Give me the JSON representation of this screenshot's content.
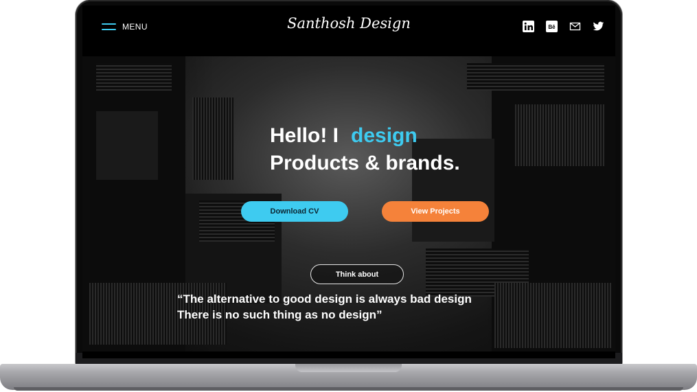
{
  "navbar": {
    "menu_label": "MENU",
    "logo": "Santhosh Design",
    "social_icons": [
      "linkedin-icon",
      "behance-icon",
      "mail-icon",
      "twitter-icon"
    ]
  },
  "hero": {
    "headline_line1": "Hello! I",
    "headline_word": "design",
    "headline_line2": "Products & brands.",
    "download_label": "Download CV",
    "projects_label": "View Projects",
    "think_label": "Think about",
    "quote_line1": "“The alternative to good design is always bad design",
    "quote_line2": "There is no such thing as no design”"
  },
  "colors": {
    "accent_blue": "#3ecbf0",
    "accent_orange": "#f5823a",
    "background": "#000000"
  }
}
